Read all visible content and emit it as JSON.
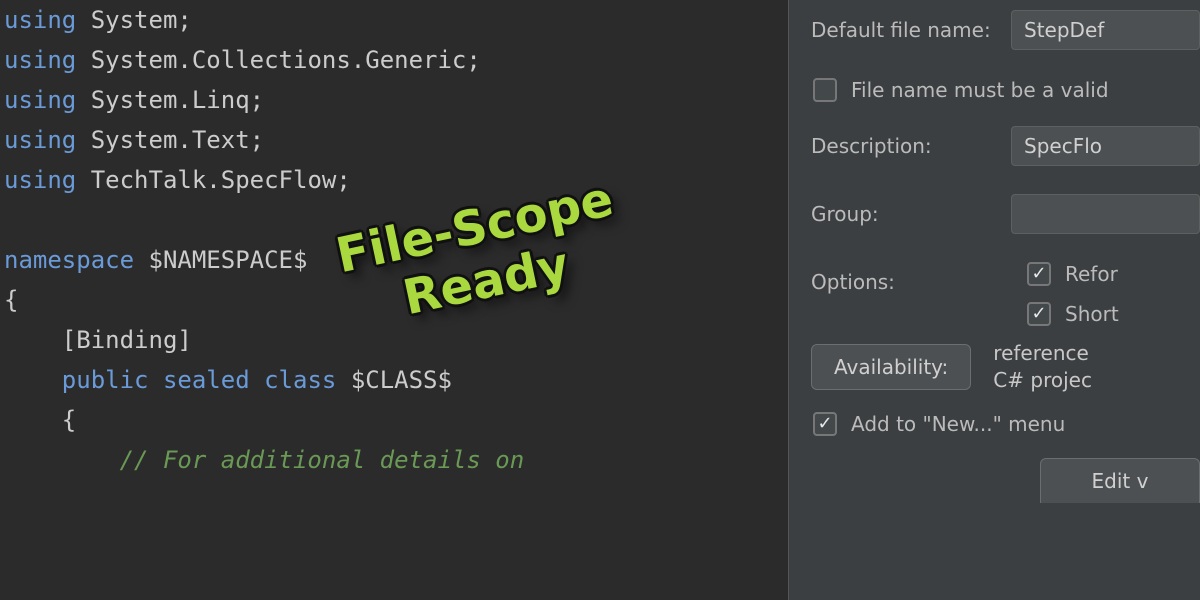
{
  "code": {
    "using_kw": "using",
    "u1": "System",
    "u2": "System.Collections.Generic",
    "u3": "System.Linq",
    "u4": "System.Text",
    "u5": "TechTalk.SpecFlow",
    "semicolon": ";",
    "namespace_kw": "namespace",
    "namespace_ph": "$NAMESPACE$",
    "open_brace": "{",
    "close_brace": "}",
    "attr": "[Binding]",
    "public_kw": "public",
    "sealed_kw": "sealed",
    "class_kw": "class",
    "class_ph": "$CLASS$",
    "comment": "// For additional details on"
  },
  "panel": {
    "default_file_name_label": "Default file name:",
    "default_file_name_value": "StepDef",
    "file_name_valid_label": "File name must be a valid",
    "description_label": "Description:",
    "description_value": "SpecFlo",
    "group_label": "Group:",
    "group_value": "",
    "options_label": "Options:",
    "opt_reformat": "Refor",
    "opt_shorten": "Short",
    "availability_button": "Availability:",
    "availability_text_l1": "reference",
    "availability_text_l2": "C# projec",
    "add_new_menu": "Add to \"New...\" menu",
    "edit_button": "Edit v"
  },
  "overlay": {
    "line1": "File-Scope",
    "line2": "Ready"
  }
}
